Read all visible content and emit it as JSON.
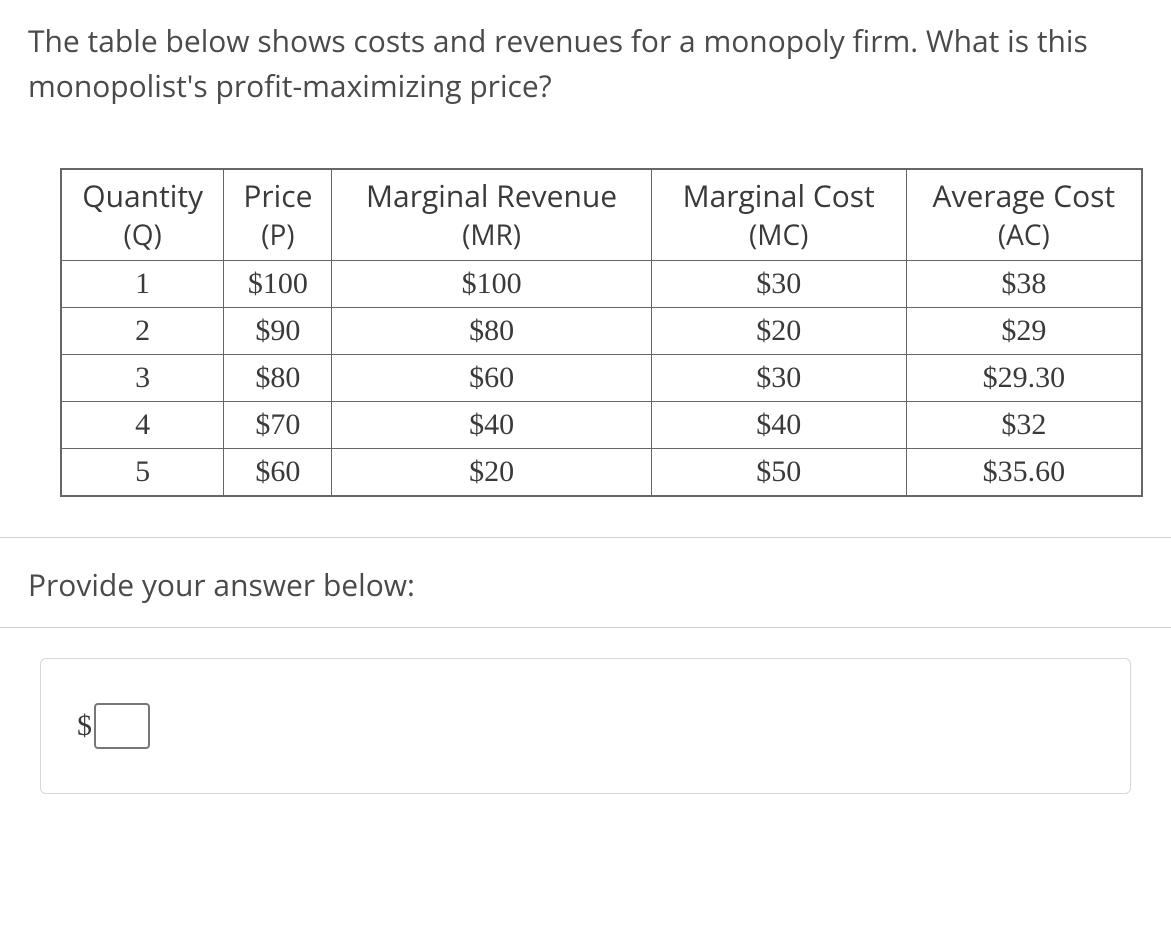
{
  "question": "The table below shows costs and revenues for a monopoly firm. What is this monopolist's profit-maximizing price?",
  "table": {
    "headers": [
      {
        "title": "Quantity",
        "abbr": "(Q)"
      },
      {
        "title": "Price",
        "abbr": "(P)"
      },
      {
        "title": "Marginal Revenue",
        "abbr": "(MR)"
      },
      {
        "title": "Marginal Cost",
        "abbr": "(MC)"
      },
      {
        "title": "Average Cost",
        "abbr": "(AC)"
      }
    ],
    "rows": [
      {
        "q": "1",
        "p": "$100",
        "mr": "$100",
        "mc": "$30",
        "ac": "$38"
      },
      {
        "q": "2",
        "p": "$90",
        "mr": "$80",
        "mc": "$20",
        "ac": "$29"
      },
      {
        "q": "3",
        "p": "$80",
        "mr": "$60",
        "mc": "$30",
        "ac": "$29.30"
      },
      {
        "q": "4",
        "p": "$70",
        "mr": "$40",
        "mc": "$40",
        "ac": "$32"
      },
      {
        "q": "5",
        "p": "$60",
        "mr": "$20",
        "mc": "$50",
        "ac": "$35.60"
      }
    ]
  },
  "prompt_label": "Provide your answer below:",
  "currency_symbol": "$",
  "answer_value": ""
}
